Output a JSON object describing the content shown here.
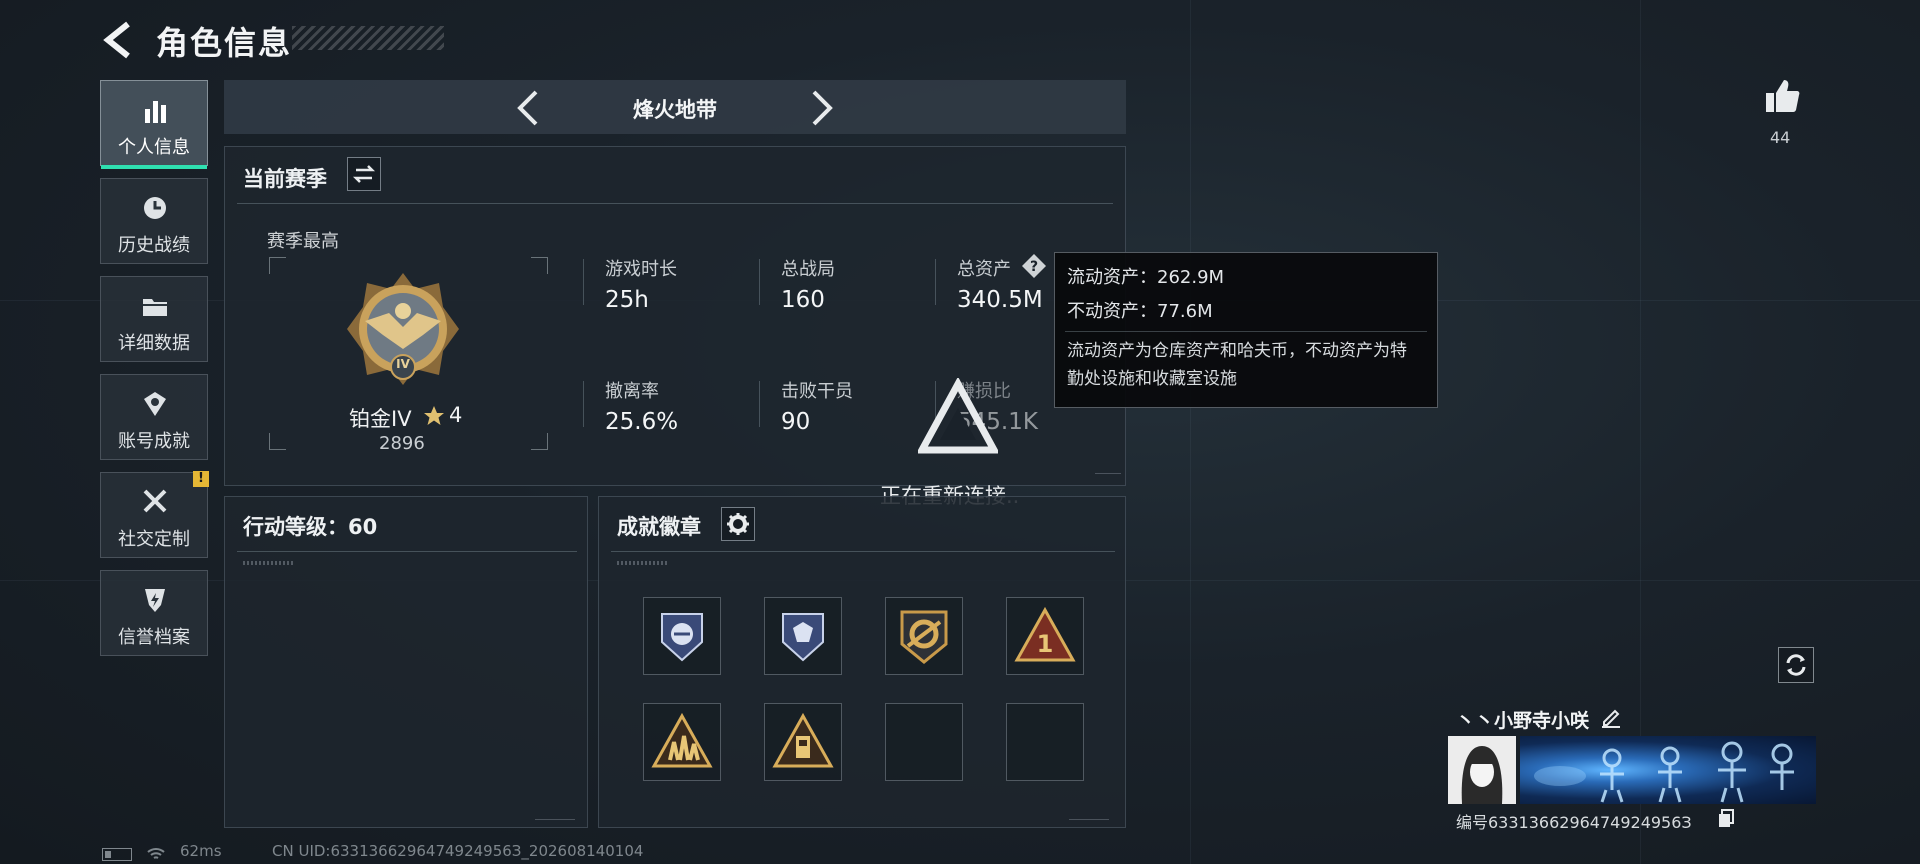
{
  "header": {
    "title": "角色信息",
    "back_icon": "chevron-left-icon"
  },
  "sidebar": {
    "items": [
      {
        "label": "个人信息",
        "icon": "bar-chart-icon",
        "active": true
      },
      {
        "label": "历史战绩",
        "icon": "clock-history-icon"
      },
      {
        "label": "详细数据",
        "icon": "folder-icon"
      },
      {
        "label": "账号成就",
        "icon": "achievement-icon"
      },
      {
        "label": "社交定制",
        "icon": "tools-icon",
        "badge": "!"
      },
      {
        "label": "信誉档案",
        "icon": "shield-bolt-icon"
      }
    ]
  },
  "mode_selector": {
    "name": "烽火地带"
  },
  "season": {
    "title": "当前赛季",
    "best_label": "赛季最高",
    "rank_name": "铂金IV",
    "rank_stars": "4",
    "rank_emblem_numeral": "IV",
    "rank_score": "2896",
    "stats": [
      {
        "label": "游戏时长",
        "value": "25h"
      },
      {
        "label": "总战局",
        "value": "160"
      },
      {
        "label": "总资产",
        "value": "340.5M"
      },
      {
        "label": "撤离率",
        "value": "25.6%"
      },
      {
        "label": "击败干员",
        "value": "90"
      },
      {
        "label": "赚损比",
        "value": "545.1K"
      }
    ]
  },
  "tooltip": {
    "liquid": "流动资产：262.9M",
    "fixed": "不动资产：77.6M",
    "description": "流动资产为仓库资产和哈夫币，不动资产为特勤处设施和收藏室设施"
  },
  "action_level": {
    "title": "行动等级：60"
  },
  "badges": {
    "title": "成就徽章",
    "items": [
      {
        "name": "blue-shield-badge-1"
      },
      {
        "name": "blue-shield-badge-2"
      },
      {
        "name": "gold-gear-badge"
      },
      {
        "name": "triangle-1-badge",
        "text": "1"
      },
      {
        "name": "triangle-team-badge"
      },
      {
        "name": "triangle-tower-badge"
      },
      {
        "name": "empty"
      },
      {
        "name": "empty"
      }
    ]
  },
  "reconnect": {
    "text": "正在重新连接.."
  },
  "likes": {
    "count": "44"
  },
  "player": {
    "name": "丶丶小野寺小咲",
    "id_text": "编号6331366296474924956З"
  },
  "status": {
    "ping": "62ms",
    "uid": "CN UID:6331366296474924956З_202608140104"
  },
  "colors": {
    "accent": "#2fe0b0",
    "warning": "#e5b735",
    "gold": "#c99a4a"
  }
}
